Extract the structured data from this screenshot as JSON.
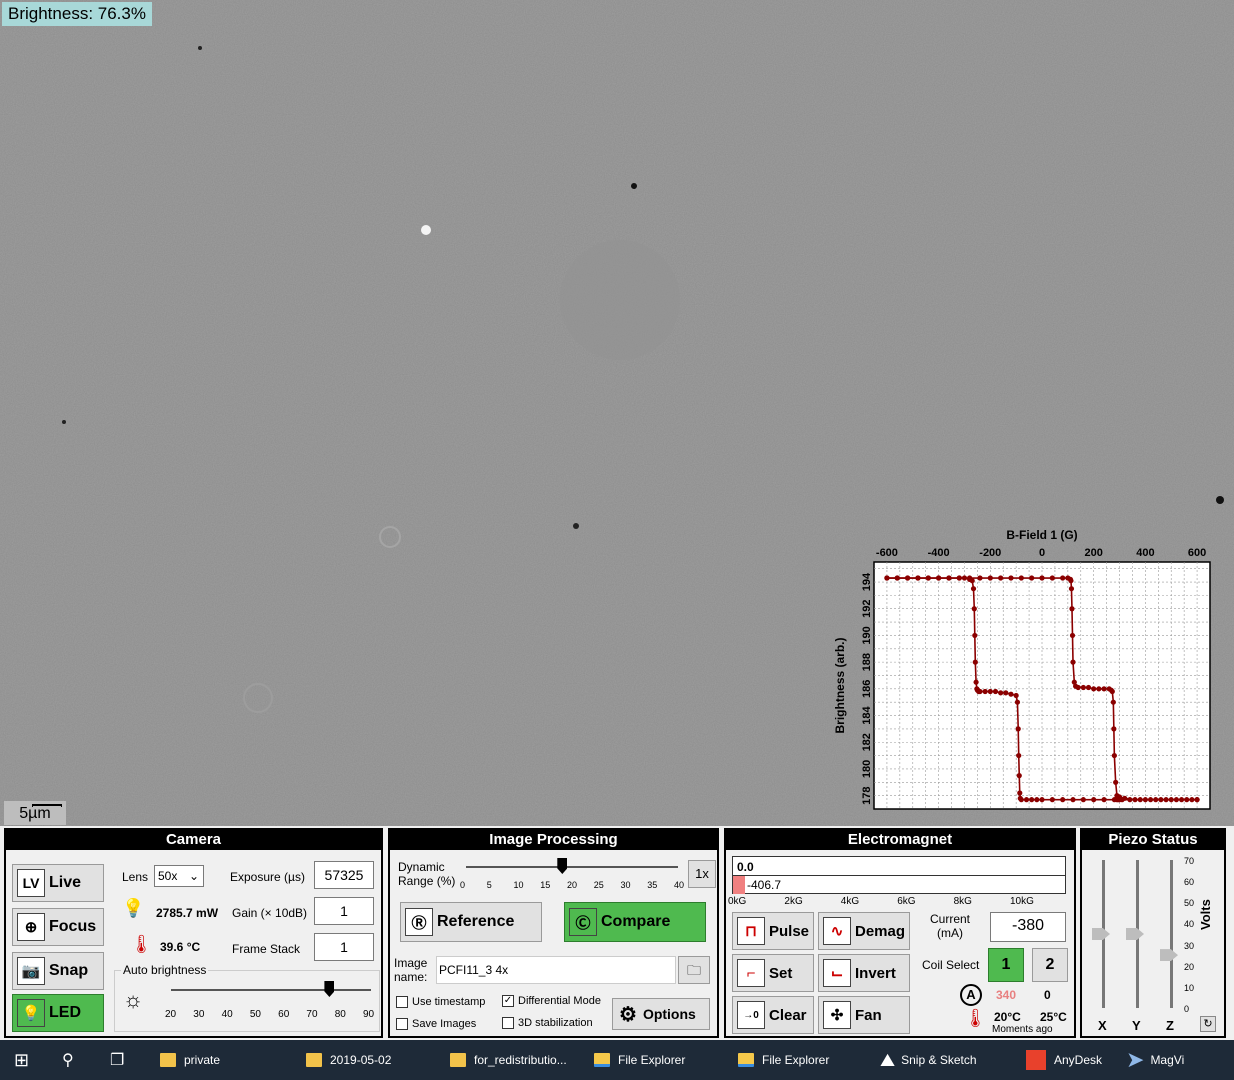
{
  "viewer": {
    "brightness_label": "Brightness: 76.3%",
    "scalebar_label": "5µm"
  },
  "chart_data": {
    "type": "line",
    "title": "",
    "xlabel": "B-Field 1 (G)",
    "ylabel": "Brightness (arb.)",
    "xlim": [
      -650,
      650
    ],
    "ylim": [
      177,
      195.5
    ],
    "xticks": [
      -600,
      -400,
      -200,
      0,
      200,
      400,
      600
    ],
    "yticks": [
      178,
      180,
      182,
      184,
      186,
      188,
      190,
      192,
      194
    ],
    "grid": true,
    "series": [
      {
        "color": "#8b0000",
        "x": [
          -600,
          -560,
          -520,
          -480,
          -440,
          -400,
          -360,
          -320,
          -300,
          -280,
          -270,
          -265,
          -262,
          -260,
          -258,
          -255,
          -252,
          -250,
          -248,
          -245,
          -240,
          -220,
          -200,
          -180,
          -160,
          -140,
          -120,
          -100,
          -95,
          -92,
          -90,
          -88,
          -86,
          -84,
          -80,
          -60,
          -40,
          -20,
          0,
          40,
          80,
          120,
          160,
          200,
          240,
          280,
          290,
          295,
          300,
          310,
          340,
          380,
          420,
          460,
          500,
          540,
          580,
          600
        ],
        "y": [
          194.3,
          194.3,
          194.3,
          194.3,
          194.3,
          194.3,
          194.3,
          194.3,
          194.3,
          194.2,
          194.1,
          193.5,
          192,
          190,
          188,
          186.5,
          186,
          185.9,
          185.9,
          185.8,
          185.8,
          185.8,
          185.8,
          185.8,
          185.7,
          185.7,
          185.6,
          185.5,
          185,
          183,
          181,
          179.5,
          178.2,
          177.8,
          177.7,
          177.7,
          177.7,
          177.7,
          177.7,
          177.7,
          177.7,
          177.7,
          177.7,
          177.7,
          177.7,
          177.7,
          177.7,
          177.7,
          177.7,
          177.7,
          177.7,
          177.7,
          177.7,
          177.7,
          177.7,
          177.7,
          177.7,
          177.7
        ]
      },
      {
        "color": "#8b0000",
        "x": [
          600,
          560,
          520,
          480,
          440,
          400,
          360,
          320,
          300,
          290,
          285,
          280,
          278,
          276,
          272,
          268,
          260,
          240,
          220,
          200,
          180,
          160,
          140,
          130,
          125,
          120,
          118,
          116,
          114,
          112,
          110,
          100,
          80,
          40,
          0,
          -40,
          -80,
          -120,
          -160,
          -200,
          -240,
          -280,
          -320,
          -360,
          -400,
          -440,
          -480,
          -520,
          -560,
          -600
        ],
        "y": [
          177.7,
          177.7,
          177.7,
          177.7,
          177.7,
          177.7,
          177.7,
          177.8,
          177.9,
          178,
          179,
          181,
          183,
          185,
          185.8,
          185.9,
          186,
          186,
          186,
          186,
          186.1,
          186.1,
          186.1,
          186.2,
          186.5,
          188,
          190,
          192,
          193.5,
          194.1,
          194.2,
          194.3,
          194.3,
          194.3,
          194.3,
          194.3,
          194.3,
          194.3,
          194.3,
          194.3,
          194.3,
          194.3,
          194.3,
          194.3,
          194.3,
          194.3,
          194.3,
          194.3,
          194.3,
          194.3
        ]
      }
    ]
  },
  "camera": {
    "title": "Camera",
    "live_label": "Live",
    "live_icon_text": "LV",
    "focus_label": "Focus",
    "snap_label": "Snap",
    "led_label": "LED",
    "lens_label": "Lens",
    "lens_value": "50x",
    "exposure_label": "Exposure (µs)",
    "exposure_value": "57325",
    "power_value": "2785.7  mW",
    "gain_label": "Gain (× 10dB)",
    "gain_value": "1",
    "temp_value": "39.6 °C",
    "frame_stack_label": "Frame Stack",
    "frame_stack_value": "1",
    "auto_brightness_label": "Auto brightness",
    "auto_brightness_ticks": [
      "20",
      "30",
      "40",
      "50",
      "60",
      "70",
      "80",
      "90"
    ],
    "auto_brightness_value": 76
  },
  "imgproc": {
    "title": "Image Processing",
    "dynamic_range_label": "Dynamic\nRange (%)",
    "dr_ticks": [
      "0",
      "5",
      "10",
      "15",
      "20",
      "25",
      "30",
      "35",
      "40"
    ],
    "dr_value": 18,
    "zoom_label": "1x",
    "reference_label": "Reference",
    "compare_label": "Compare",
    "image_name_label": "Image\nname:",
    "image_name_value": "PCFI11_3 4x",
    "use_timestamp": "Use timestamp",
    "save_images": "Save Images",
    "differential_mode": "Differential Mode",
    "stabilization": "3D stabilization",
    "options_label": "Options"
  },
  "magnet": {
    "title": "Electromagnet",
    "field_top": "0.0",
    "field_bottom": "-406.7",
    "scale_ticks": [
      "0kG",
      "2kG",
      "4kG",
      "6kG",
      "8kG",
      "10kG"
    ],
    "field_fraction": 0.0,
    "pulse_label": "Pulse",
    "demag_label": "Demag",
    "set_label": "Set",
    "invert_label": "Invert",
    "clear_label": "Clear",
    "fan_label": "Fan",
    "current_label": "Current\n(mA)",
    "current_value": "-380",
    "coil_select_label": "Coil Select",
    "coil_1": "1",
    "coil_2": "2",
    "ammeter_value1": "340",
    "ammeter_value2": "0",
    "temp1": "20°C",
    "temp2": "25°C",
    "temp_time": "Moments ago",
    "accent_red": "#e88080"
  },
  "piezo": {
    "title": "Piezo Status",
    "ticks": [
      "70",
      "60",
      "50",
      "40",
      "30",
      "20",
      "10",
      "0"
    ],
    "volts_label": "Volts",
    "axes": [
      "X",
      "Y",
      "Z"
    ],
    "levels": [
      35,
      35,
      25
    ],
    "refresh_icon": "refresh-icon"
  },
  "taskbar": {
    "items": [
      "private",
      "2019-05-02",
      "for_redistributio...",
      "File Explorer",
      "File Explorer",
      "Snip & Sketch",
      "AnyDesk"
    ],
    "tray_text": "MagVi"
  }
}
